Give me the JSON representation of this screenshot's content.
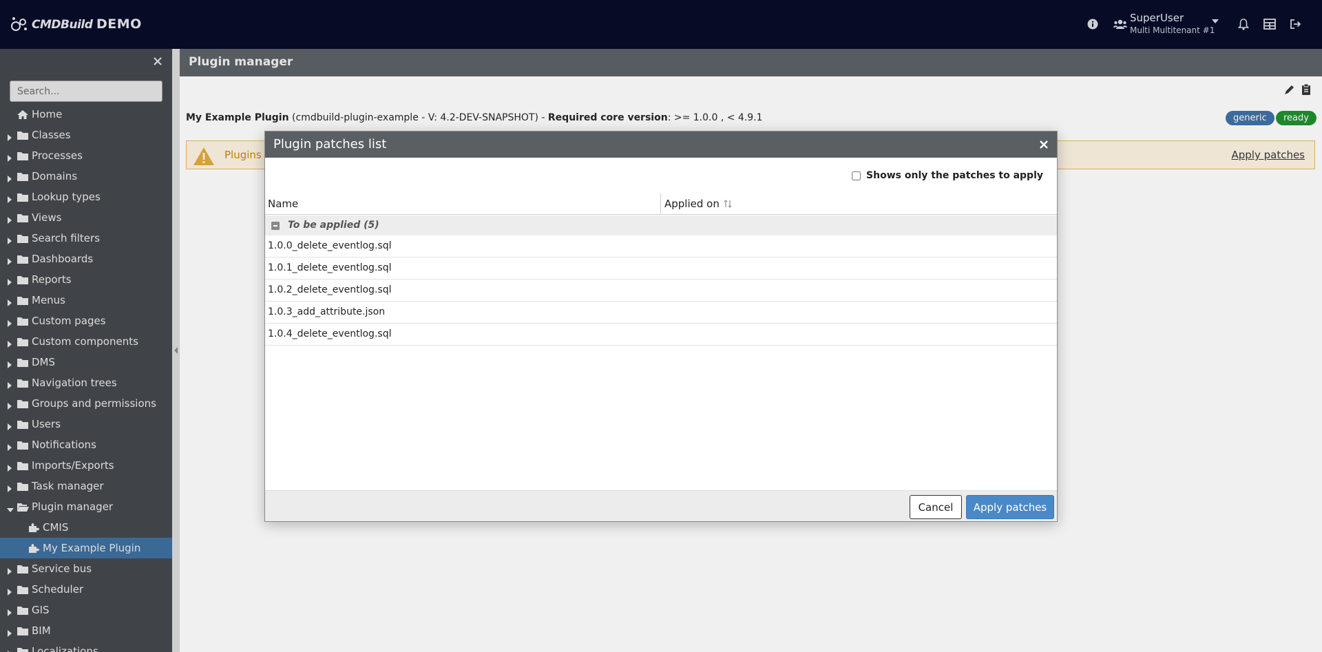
{
  "header": {
    "logo_text": "CMDBuild",
    "app_name": "DEMO",
    "user_name": "SuperUser",
    "user_tenant": "Multi Multitenant #1",
    "icons": [
      "info-icon",
      "users-icon",
      "chevron-down-icon",
      "bell-icon",
      "grid-icon",
      "logout-icon"
    ]
  },
  "sidebar": {
    "search_placeholder": "Search...",
    "items": [
      {
        "label": "Home",
        "icon": "home-icon",
        "level": 0,
        "expandable": false
      },
      {
        "label": "Classes",
        "icon": "folder-icon",
        "level": 0,
        "expandable": true
      },
      {
        "label": "Processes",
        "icon": "folder-icon",
        "level": 0,
        "expandable": true
      },
      {
        "label": "Domains",
        "icon": "folder-icon",
        "level": 0,
        "expandable": true
      },
      {
        "label": "Lookup types",
        "icon": "folder-icon",
        "level": 0,
        "expandable": true
      },
      {
        "label": "Views",
        "icon": "folder-icon",
        "level": 0,
        "expandable": true
      },
      {
        "label": "Search filters",
        "icon": "folder-icon",
        "level": 0,
        "expandable": true
      },
      {
        "label": "Dashboards",
        "icon": "folder-icon",
        "level": 0,
        "expandable": true
      },
      {
        "label": "Reports",
        "icon": "folder-icon",
        "level": 0,
        "expandable": true
      },
      {
        "label": "Menus",
        "icon": "folder-icon",
        "level": 0,
        "expandable": true
      },
      {
        "label": "Custom pages",
        "icon": "folder-icon",
        "level": 0,
        "expandable": true
      },
      {
        "label": "Custom components",
        "icon": "folder-icon",
        "level": 0,
        "expandable": true
      },
      {
        "label": "DMS",
        "icon": "folder-icon",
        "level": 0,
        "expandable": true
      },
      {
        "label": "Navigation trees",
        "icon": "folder-icon",
        "level": 0,
        "expandable": true
      },
      {
        "label": "Groups and permissions",
        "icon": "folder-icon",
        "level": 0,
        "expandable": true
      },
      {
        "label": "Users",
        "icon": "folder-icon",
        "level": 0,
        "expandable": true
      },
      {
        "label": "Notifications",
        "icon": "folder-icon",
        "level": 0,
        "expandable": true
      },
      {
        "label": "Imports/Exports",
        "icon": "folder-icon",
        "level": 0,
        "expandable": true
      },
      {
        "label": "Task manager",
        "icon": "folder-icon",
        "level": 0,
        "expandable": true
      },
      {
        "label": "Plugin manager",
        "icon": "folder-open-icon",
        "level": 0,
        "expandable": true,
        "expanded": true
      },
      {
        "label": "CMIS",
        "icon": "puzzle-icon",
        "level": 1,
        "expandable": false
      },
      {
        "label": "My Example Plugin",
        "icon": "puzzle-icon",
        "level": 1,
        "expandable": false,
        "selected": true
      },
      {
        "label": "Service bus",
        "icon": "folder-icon",
        "level": 0,
        "expandable": true
      },
      {
        "label": "Scheduler",
        "icon": "folder-icon",
        "level": 0,
        "expandable": true
      },
      {
        "label": "GIS",
        "icon": "folder-icon",
        "level": 0,
        "expandable": true
      },
      {
        "label": "BIM",
        "icon": "folder-icon",
        "level": 0,
        "expandable": true
      },
      {
        "label": "Localizations",
        "icon": "folder-icon",
        "level": 0,
        "expandable": true
      }
    ]
  },
  "main": {
    "title": "Plugin manager",
    "plugin_name": "My Example Plugin",
    "plugin_meta": "(cmdbuild-plugin-example - V: 4.2-DEV-SNAPSHOT) -",
    "core_version_label": "Required core version",
    "core_version_value": ": >= 1.0.0 , < 4.9.1",
    "badges": [
      "generic",
      "ready"
    ],
    "warning_text": "Plugins w",
    "warning_link": "Apply patches"
  },
  "modal": {
    "title": "Plugin patches list",
    "checkbox_label": "Shows only the patches to apply",
    "checkbox_checked": false,
    "columns": [
      "Name",
      "Applied on"
    ],
    "group_label": "To be applied (5)",
    "rows": [
      {
        "name": "1.0.0_delete_eventlog.sql",
        "applied_on": ""
      },
      {
        "name": "1.0.1_delete_eventlog.sql",
        "applied_on": ""
      },
      {
        "name": "1.0.2_delete_eventlog.sql",
        "applied_on": ""
      },
      {
        "name": "1.0.3_add_attribute.json",
        "applied_on": ""
      },
      {
        "name": "1.0.4_delete_eventlog.sql",
        "applied_on": ""
      }
    ],
    "cancel_label": "Cancel",
    "apply_label": "Apply patches"
  },
  "colors": {
    "header_bg": "#020824",
    "sidebar_bg": "#41454a",
    "selected_bg": "#3b6d9e",
    "accent": "#4a89c8",
    "badge_generic": "#3b6ea5",
    "badge_ready": "#1d8e2a",
    "warning": "#c98600"
  }
}
